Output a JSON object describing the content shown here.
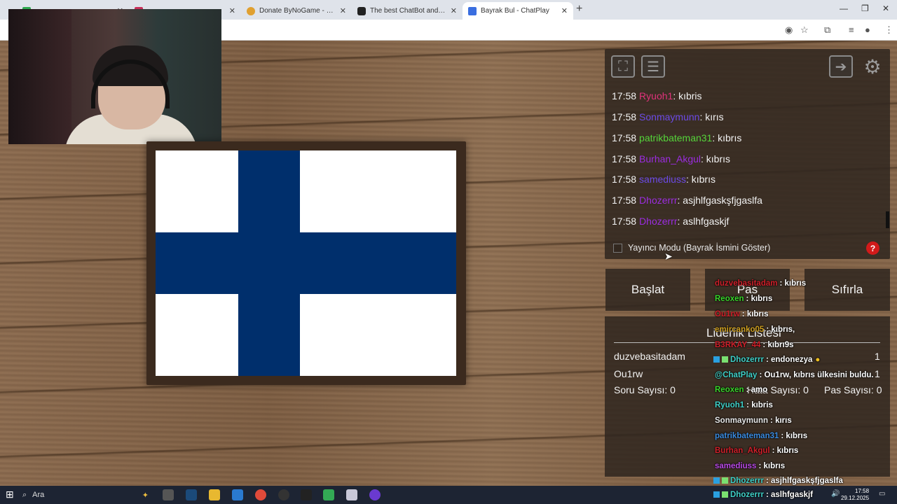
{
  "browser": {
    "tabs": [
      {
        "label": "",
        "active": false
      },
      {
        "label": "",
        "active": false
      },
      {
        "label": "Donate ByNoGame - Gelen/Gi",
        "active": false
      },
      {
        "label": "The best ChatBot and Widgets",
        "active": false
      },
      {
        "label": "Bayrak Bul - ChatPlay",
        "active": true
      }
    ],
    "new_tab": "+",
    "controls": {
      "minimize": "—",
      "restore": "❐",
      "close": "✕"
    }
  },
  "chat": {
    "messages": [
      {
        "time": "17:58",
        "user": "Ryuoh1",
        "text": ": kıbris",
        "color": "#e0327a"
      },
      {
        "time": "17:58",
        "user": "Sonmaymunn",
        "text": ": kırıs",
        "color": "#6b4ae6"
      },
      {
        "time": "17:58",
        "user": "patrikbateman31",
        "text": ": kıbrıs",
        "color": "#55d43a"
      },
      {
        "time": "17:58",
        "user": "Burhan_Akgul",
        "text": ": kıbrıs",
        "color": "#9b2ce0"
      },
      {
        "time": "17:58",
        "user": "samediuss",
        "text": ": kıbrıs",
        "color": "#6b4ae6"
      },
      {
        "time": "17:58",
        "user": "Dhozerrr",
        "text": ": asjhlfgaskşfjgaslfa",
        "color": "#9b2ce0"
      },
      {
        "time": "17:58",
        "user": "Dhozerrr",
        "text": ": aslhfgaskjf",
        "color": "#9b2ce0"
      }
    ]
  },
  "mode": {
    "label": "Yayıncı Modu (Bayrak İsmini Göster)",
    "help": "?"
  },
  "buttons": {
    "start": "Başlat",
    "pass": "Pas",
    "reset": "Sıfırla"
  },
  "leaderboard": {
    "title": "Liderlik Listesi",
    "entries": [
      {
        "name": "duzvebasitadam",
        "score": "1"
      },
      {
        "name": "Ou1rw",
        "score": "1"
      }
    ],
    "stats": {
      "questions": "Soru Sayısı: 0",
      "errors": "Hata Sayısı: 0",
      "passes": "Pas Sayısı: 0"
    }
  },
  "overlay": {
    "lines": [
      {
        "name": "duzvebasitadam",
        "text": ": kıbrıs",
        "color": "#d0202a",
        "icons": false
      },
      {
        "name": "Reoxen",
        "text": ": kıbrıs",
        "color": "#38d42a",
        "icons": false
      },
      {
        "name": "Ou1rw",
        "text": ": kıbrıs",
        "color": "#d0202a",
        "icons": false
      },
      {
        "name": "emircanko05",
        "text": ": kıbrıs,",
        "color": "#d0a020",
        "icons": false
      },
      {
        "name": "B3RKAY_44",
        "text": ": kıbrı9s",
        "color": "#d0202a",
        "icons": false
      },
      {
        "name": "Dhozerrr",
        "text": ": endonezya",
        "color": "#3fd0c8",
        "icons": true
      },
      {
        "name": "@ChatPlay",
        "text": ": Ou1rw, kıbrıs ülkesini buldu.",
        "color": "#3fd0c8",
        "icons": false
      },
      {
        "name": "Reoxen",
        "text": ": amo",
        "color": "#38d42a",
        "icons": false
      },
      {
        "name": "Ryuoh1",
        "text": ": kıbris",
        "color": "#3fd0c8",
        "icons": false
      },
      {
        "name": "Sonmaymunn",
        "text": ": kırıs",
        "color": "#e8e8e8",
        "icons": false
      },
      {
        "name": "patrikbateman31",
        "text": ": kıbrıs",
        "color": "#3a8be0",
        "icons": false
      },
      {
        "name": "Burhan_Akgul",
        "text": ": kıbrıs",
        "color": "#d0202a",
        "icons": false
      },
      {
        "name": "samediuss",
        "text": ": kıbrıs",
        "color": "#b94ae6",
        "icons": false
      },
      {
        "name": "Dhozerrr",
        "text": ": asjhlfgaskşfjgaslfa",
        "color": "#3fd0c8",
        "icons": true
      },
      {
        "name": "Dhozerrr",
        "text": ": aslhfgaskjf",
        "color": "#3fd0c8",
        "icons": true
      }
    ]
  },
  "taskbar": {
    "search_placeholder": "Ara",
    "time": "17:58",
    "date": "29.12.2025"
  },
  "colors": {
    "flag_blue": "#002f6c",
    "panel_bg": "#30262099",
    "help_red": "#d21a1a"
  }
}
